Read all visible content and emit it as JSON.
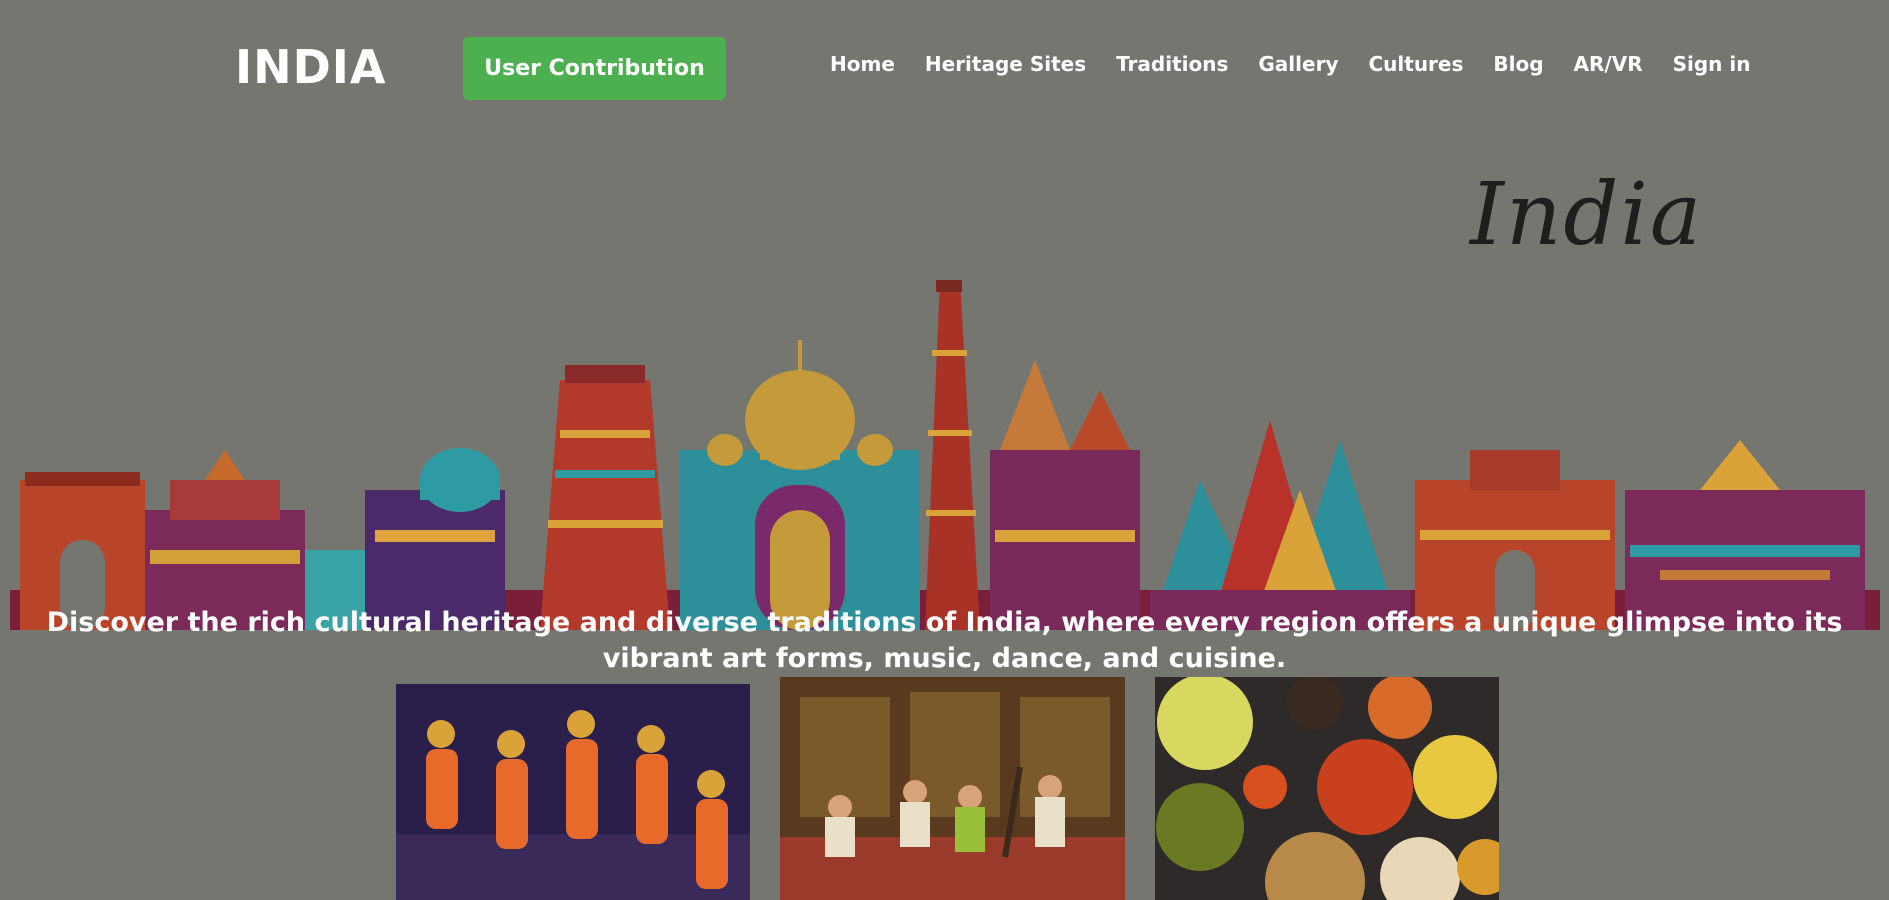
{
  "brand": "INDIA",
  "contribute_label": "User Contribution",
  "nav": [
    "Home",
    "Heritage Sites",
    "Traditions",
    "Gallery",
    "Cultures",
    "Blog",
    "AR/VR",
    "Sign in"
  ],
  "hero": {
    "script_title": "India",
    "tagline": "Discover the rich cultural heritage and diverse traditions of India, where every region offers a unique glimpse into its vibrant art forms, music, dance, and cuisine."
  },
  "colors": {
    "background": "#757670",
    "button": "#4caf50"
  }
}
